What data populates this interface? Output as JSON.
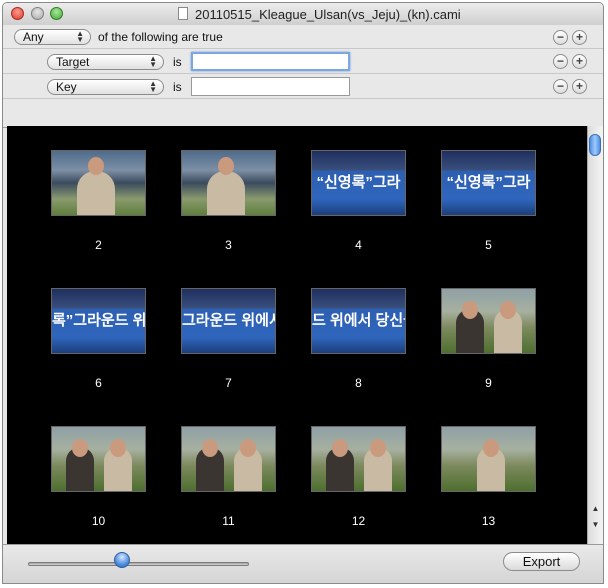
{
  "window": {
    "title": "20110515_Kleague_Ulsan(vs_Jeju)_(kn).cami"
  },
  "rules": {
    "match_mode": {
      "selected": "Any",
      "suffix": "of the following are true"
    },
    "rows": [
      {
        "field": "Target",
        "operator": "is",
        "value": ""
      },
      {
        "field": "Key",
        "operator": "is",
        "value": ""
      }
    ],
    "remove_symbol": "−",
    "add_symbol": "+"
  },
  "thumbnails": [
    {
      "label": "2",
      "scene": "interview-man"
    },
    {
      "label": "3",
      "scene": "interview-man"
    },
    {
      "label": "4",
      "scene": "banner",
      "caption": "“신영록”그라"
    },
    {
      "label": "5",
      "scene": "banner",
      "caption": "“신영록”그라"
    },
    {
      "label": "6",
      "scene": "banner",
      "caption": "록”그라운드 위에서 당"
    },
    {
      "label": "7",
      "scene": "banner",
      "caption": "그라운드 위에서 당신을 기다립"
    },
    {
      "label": "8",
      "scene": "banner",
      "caption": "드 위에서 당신을 기다립니다!"
    },
    {
      "label": "9",
      "scene": "interview-pair"
    },
    {
      "label": "10",
      "scene": "interview-pair"
    },
    {
      "label": "11",
      "scene": "interview-pair"
    },
    {
      "label": "12",
      "scene": "interview-pair"
    },
    {
      "label": "13",
      "scene": "interview-woman"
    }
  ],
  "scrollbar": {
    "up_arrow": "▲",
    "down_arrow": "▼",
    "position": 0.0
  },
  "footer": {
    "zoom_slider_value": 0.42,
    "export_label": "Export"
  }
}
